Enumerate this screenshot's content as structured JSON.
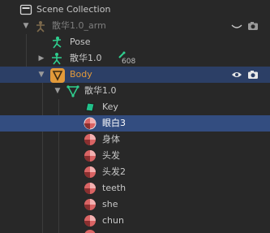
{
  "outliner": {
    "rows": [
      {
        "label": "Scene Collection"
      },
      {
        "label": "散华1.0_arm"
      },
      {
        "label": "Pose"
      },
      {
        "label": "散华1.0",
        "badge": "608"
      },
      {
        "label": "Body"
      },
      {
        "label": "散华1.0"
      },
      {
        "label": "Key"
      },
      {
        "label": "眼白3"
      },
      {
        "label": "身体"
      },
      {
        "label": "头发"
      },
      {
        "label": "头发2"
      },
      {
        "label": "teeth"
      },
      {
        "label": "she"
      },
      {
        "label": "chun"
      }
    ]
  },
  "colors": {
    "background": "#282828",
    "selected_row": "#334d80",
    "body_row": "#2c3f66",
    "material_icon": "#d96464",
    "shapekey_icon": "#22c08a",
    "armature_icon": "#e39a3a",
    "text_orange": "#e39a3a"
  }
}
